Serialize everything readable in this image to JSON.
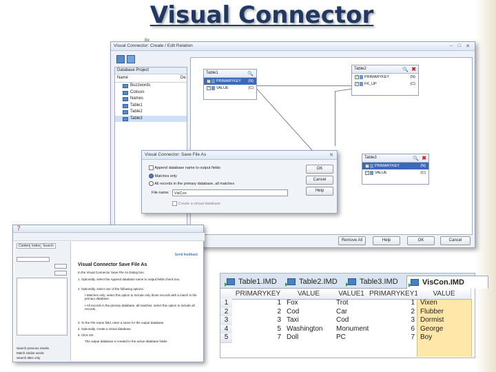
{
  "title": "Visual Connector",
  "small_label": "Bx",
  "main_dialog": {
    "title": "Visual Connector: Create / Edit Relation",
    "tree_header": "Database Project",
    "col_name": "Name",
    "col_desc": "De",
    "tree_items": [
      "Buzzwords",
      "Colours",
      "Names",
      "Table1",
      "Table2",
      "Table3"
    ],
    "table1": {
      "title": "Table1",
      "cols": [
        {
          "name": "PRIMARYKEY",
          "type": "(N)"
        },
        {
          "name": "VALUE",
          "type": "(C)"
        }
      ]
    },
    "table2": {
      "title": "Table2",
      "cols": [
        {
          "name": "PRIMARYKEY",
          "type": "(N)"
        },
        {
          "name": "FK_UP",
          "type": "(C)"
        }
      ]
    },
    "table3": {
      "title": "Table3",
      "cols": [
        {
          "name": "PRIMARYKEY",
          "type": "(N)"
        },
        {
          "name": "VALUE",
          "type": "(C)"
        }
      ]
    },
    "buttons": [
      "Remove All",
      "Help",
      "OK",
      "Cancel"
    ]
  },
  "save_dialog": {
    "title": "Visual Connector: Save File As",
    "opt_append": "Append database name to output fields",
    "opt_matches": "Matches only",
    "opt_all": "All records in the primary database, all matches",
    "file_label": "File name:",
    "file_value": "VisCon",
    "opt_virtual": "Create a virtual database",
    "buttons": [
      "OK",
      "Cancel",
      "Help"
    ]
  },
  "help_window": {
    "title": "Visual Connector Save File As",
    "feedback": "Send feedback",
    "tabs": [
      "Contents",
      "Index",
      "Search"
    ],
    "intro": "In the Visual Connector Save File As Dialog box:",
    "steps": [
      "Optionally, select the Append database name to output fields check box.",
      "Optionally, select one of the following options:",
      "To the File name field, enter a name for the output database.",
      "Optionally, create a virtual database.",
      "Click OK."
    ],
    "bullets": [
      "Matches only: select this option to include only those records with a match in the primary database.",
      "All records in the primary database, all matches: select this option to include all records."
    ],
    "footer": "The output database is created in the active database folder.",
    "side_items": [
      "Search previous results",
      "Match similar words",
      "Search titles only"
    ]
  },
  "grid": {
    "tabs": [
      "Table1.IMD",
      "Table2.IMD",
      "Table3.IMD",
      "VisCon.IMD"
    ],
    "active_tab": 3,
    "headers": [
      "PRIMARYKEY",
      "VALUE",
      "VALUE1",
      "PRIMARYKEY1",
      "VALUE"
    ],
    "rows": [
      {
        "n": "1",
        "pk": "1",
        "v": "Fox",
        "v1": "Trot",
        "pk1": "1",
        "v2": "Vixen"
      },
      {
        "n": "2",
        "pk": "2",
        "v": "Cod",
        "v1": "Car",
        "pk1": "2",
        "v2": "Flubber"
      },
      {
        "n": "3",
        "pk": "3",
        "v": "Taxi",
        "v1": "Cod",
        "pk1": "3",
        "v2": "Dormist"
      },
      {
        "n": "4",
        "pk": "5",
        "v": "Washington",
        "v1": "Monument",
        "pk1": "6",
        "v2": "George"
      },
      {
        "n": "5",
        "pk": "7",
        "v": "Doll",
        "v1": "PC",
        "pk1": "7",
        "v2": "Boy"
      }
    ]
  }
}
